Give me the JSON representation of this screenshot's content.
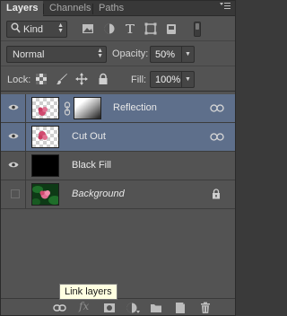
{
  "tabs": [
    {
      "label": "Layers",
      "active": true
    },
    {
      "label": "Channels",
      "active": false
    },
    {
      "label": "Paths",
      "active": false
    }
  ],
  "filter": {
    "kind_label": "Kind",
    "icons": [
      "image-filter-icon",
      "adjustment-filter-icon",
      "type-filter-icon",
      "shape-filter-icon",
      "smart-object-filter-icon"
    ]
  },
  "blend": {
    "mode": "Normal",
    "opacity_label": "Opacity:",
    "opacity_value": "50%"
  },
  "lock": {
    "label": "Lock:",
    "fill_label": "Fill:",
    "fill_value": "100%"
  },
  "layers": [
    {
      "name": "Reflection",
      "visible": true,
      "selected": true,
      "has_mask": true,
      "linked": true
    },
    {
      "name": "Cut Out",
      "visible": true,
      "selected": true,
      "has_mask": false,
      "linked": true
    },
    {
      "name": "Black Fill",
      "visible": true,
      "selected": false,
      "has_mask": false,
      "linked": false
    },
    {
      "name": "Background",
      "visible": false,
      "selected": false,
      "locked": true,
      "italic": true
    }
  ],
  "bottom_bar": {
    "icons": [
      "link-layers-icon",
      "fx-icon",
      "add-mask-icon",
      "adjustment-layer-icon",
      "new-group-icon",
      "new-layer-icon",
      "trash-icon"
    ],
    "fx_label": "fx"
  },
  "tooltip": {
    "text": "Link layers"
  },
  "colors": {
    "panel_bg": "#535353",
    "selected_bg": "#5e6f8b",
    "tooltip_bg": "#ffffe1"
  }
}
